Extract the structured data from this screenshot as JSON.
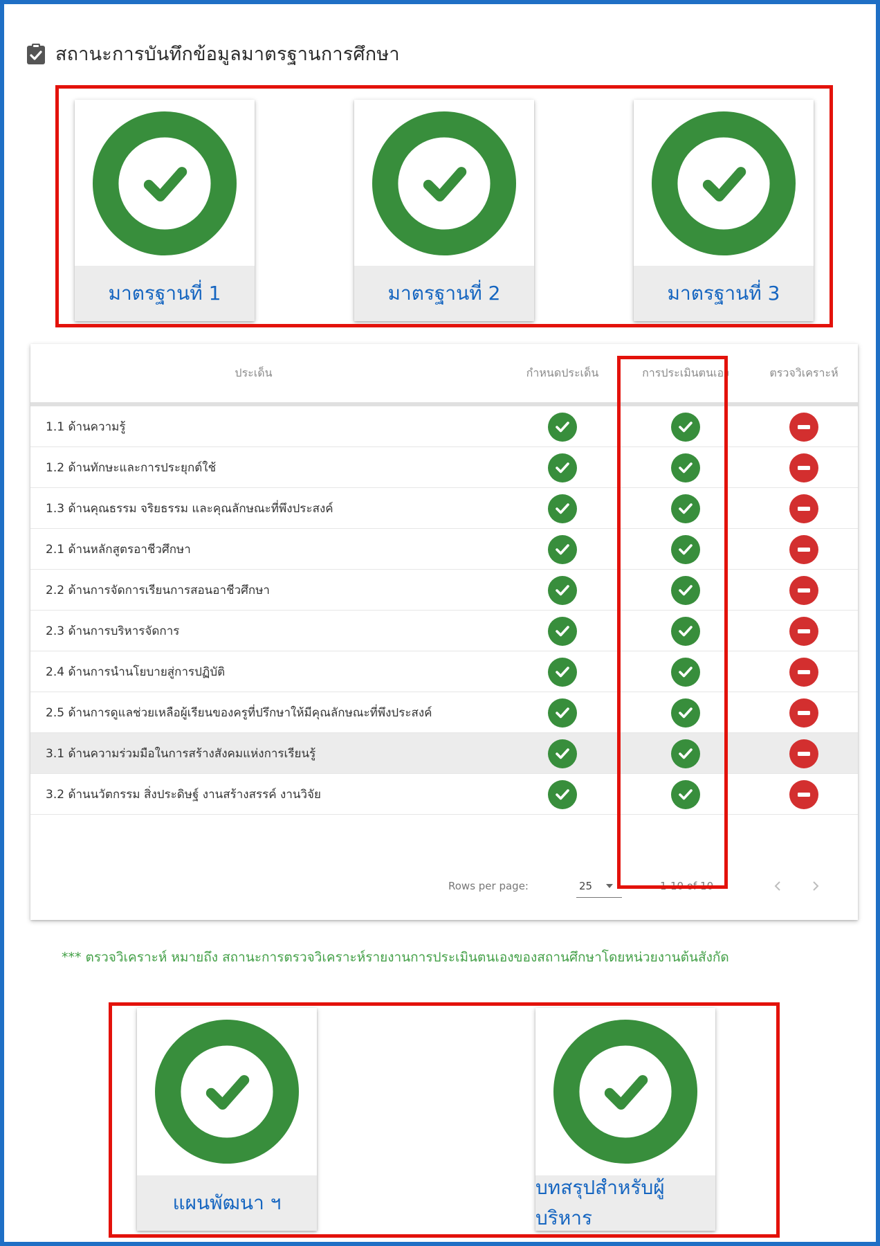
{
  "header": {
    "title": "สถานะการบันทึกข้อมูลมาตรฐานการศึกษา",
    "icon": "clipboard-check-icon"
  },
  "colors": {
    "success": "#388e3c",
    "danger": "#d32f2f",
    "highlight_box": "#e3120b",
    "frame": "#1f6fc5",
    "link": "#1565c0"
  },
  "standards": [
    {
      "label": "มาตรฐานที่ 1",
      "status": "complete"
    },
    {
      "label": "มาตรฐานที่ 2",
      "status": "complete"
    },
    {
      "label": "มาตรฐานที่ 3",
      "status": "complete"
    }
  ],
  "table": {
    "headers": [
      "ประเด็น",
      "กำหนดประเด็น",
      "การประเมินตนเอง",
      "ตรวจวิเคราะห์"
    ],
    "rows": [
      {
        "topic": "1.1 ด้านความรู้",
        "define": "check",
        "self": "check",
        "review": "minus"
      },
      {
        "topic": "1.2 ด้านทักษะและการประยุกต์ใช้",
        "define": "check",
        "self": "check",
        "review": "minus"
      },
      {
        "topic": "1.3 ด้านคุณธรรม จริยธรรม และคุณลักษณะที่พึงประสงค์",
        "define": "check",
        "self": "check",
        "review": "minus"
      },
      {
        "topic": "2.1 ด้านหลักสูตรอาชีวศึกษา",
        "define": "check",
        "self": "check",
        "review": "minus"
      },
      {
        "topic": "2.2 ด้านการจัดการเรียนการสอนอาชีวศึกษา",
        "define": "check",
        "self": "check",
        "review": "minus"
      },
      {
        "topic": "2.3 ด้านการบริหารจัดการ",
        "define": "check",
        "self": "check",
        "review": "minus"
      },
      {
        "topic": "2.4 ด้านการนำนโยบายสู่การปฏิบัติ",
        "define": "check",
        "self": "check",
        "review": "minus"
      },
      {
        "topic": "2.5 ด้านการดูแลช่วยเหลือผู้เรียนของครูที่ปรึกษาให้มีคุณลักษณะที่พึงประสงค์",
        "define": "check",
        "self": "check",
        "review": "minus"
      },
      {
        "topic": "3.1 ด้านความร่วมมือในการสร้างสังคมแห่งการเรียนรู้",
        "define": "check",
        "self": "check",
        "review": "minus"
      },
      {
        "topic": "3.2 ด้านนวัตกรรม สิ่งประดิษฐ์ งานสร้างสรรค์ งานวิจัย",
        "define": "check",
        "self": "check",
        "review": "minus"
      }
    ],
    "footer": {
      "rows_per_page_label": "Rows per page:",
      "rows_per_page_value": "25",
      "range": "1-10 of 10"
    }
  },
  "footnote": "*** ตรวจวิเคราะห์ หมายถึง สถานะการตรวจวิเคราะห์รายงานการประเมินตนเองของสถานศึกษาโดยหน่วยงานต้นสังกัด",
  "reports": [
    {
      "label": "แผนพัฒนา ฯ",
      "status": "complete"
    },
    {
      "label": "บทสรุปสำหรับผู้บริหาร",
      "status": "complete"
    }
  ]
}
